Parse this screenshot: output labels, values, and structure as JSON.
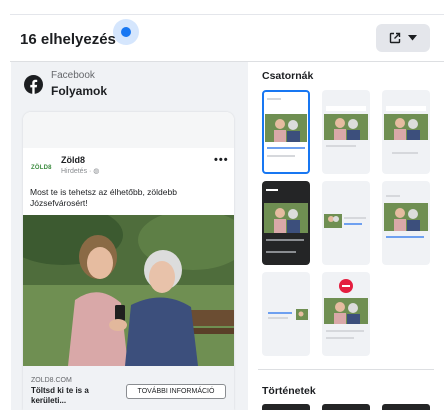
{
  "header": {
    "placement_count": "16 elhelyezés"
  },
  "preview": {
    "platform": "Facebook",
    "placement": "Folyamok",
    "advertiser": "Zöld8",
    "advertiser_logo_text": "ZÖLD8",
    "sponsored_label": "Hirdetés · ◍",
    "body_text": "Most te is tehetsz az élhetőbb, zöldebb Józsefvárosért!",
    "link_domain": "ZOLD8.COM",
    "link_headline": "Töltsd ki te is a kerületi...",
    "cta_label": "TOVÁBBI INFORMÁCIÓ"
  },
  "sections": {
    "feeds_title": "Csatornák",
    "stories_title": "Történetek"
  },
  "colors": {
    "accent": "#1877f2",
    "panel_bg": "#f0f2f5",
    "text": "#1c1e21",
    "secondary": "#65676b",
    "stop_icon": "#e41e3f"
  }
}
